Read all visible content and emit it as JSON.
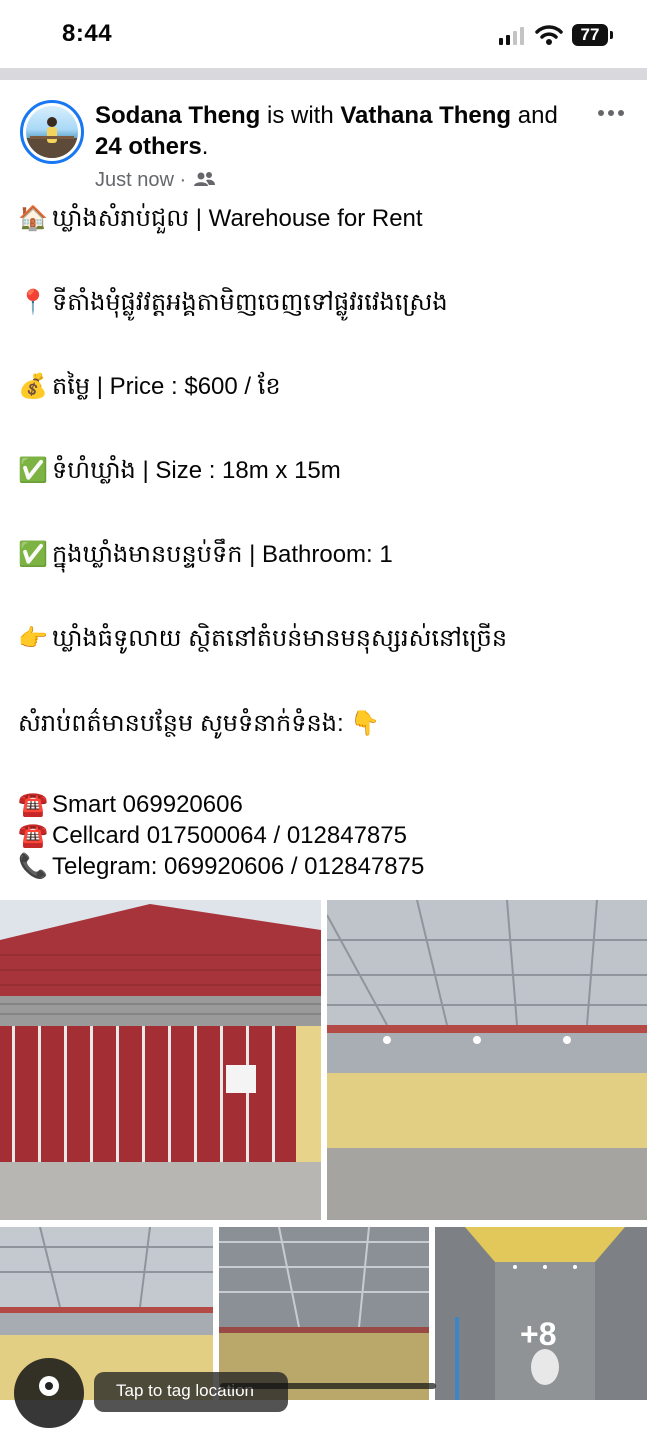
{
  "status": {
    "time": "8:44",
    "battery": "77"
  },
  "post": {
    "author": "Sodana Theng",
    "with_text": "is with",
    "tagged": "Vathana Theng",
    "and_text": "and",
    "others": "24 others",
    "period": ".",
    "timestamp": "Just now ·",
    "audience_icon": "friends-icon",
    "lines": [
      {
        "emoji": "🏠",
        "text": "ឃ្លាំងសំរាប់ជួល | Warehouse for Rent"
      },
      {
        "emoji": "📍",
        "text": "ទីតាំងមុំផ្លូវវត្តអង្គតាមិញចេញទៅផ្លូវរវេងស្រេង"
      },
      {
        "emoji": "💰",
        "text": "តម្លៃ | Price : $600 / ខែ"
      },
      {
        "emoji": "✅",
        "text": "ទំហំឃ្លាំង | Size : 18m x 15m"
      },
      {
        "emoji": "✅",
        "text": "ក្នុងឃ្លាំងមានបន្ទប់ទឹក | Bathroom: 1"
      },
      {
        "emoji": "👉",
        "text": "ឃ្លាំងធំទូលាយ ស្ថិតនៅតំបន់មានមនុស្សរស់នៅច្រើន"
      },
      {
        "emoji": "",
        "text": "សំរាប់ពត៌មានបន្ថែម សូមទំនាក់ទំនង: 👇"
      }
    ],
    "contacts": [
      {
        "emoji": "☎️",
        "text": "Smart 069920606"
      },
      {
        "emoji": "☎️",
        "text": "Cellcard 017500064 / 012847875"
      },
      {
        "emoji": "📞",
        "text": "Telegram: 069920606 / 012847875"
      }
    ],
    "more_photos": "+8",
    "tag_location": "Tap to tag location"
  },
  "colors": {
    "accent": "#1877f2",
    "roof_red": "#a8343b",
    "wall_yellow": "#e2cf84"
  }
}
